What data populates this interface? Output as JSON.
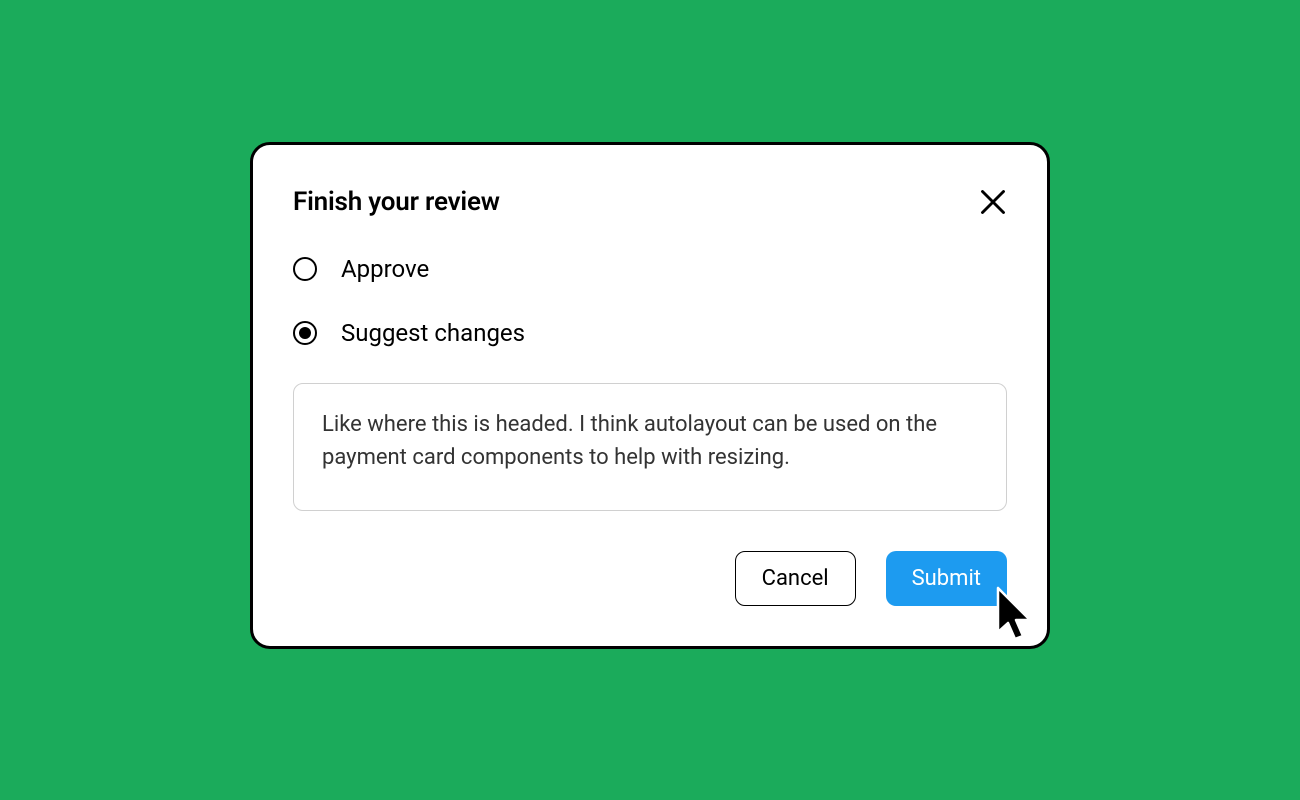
{
  "dialog": {
    "title": "Finish your review",
    "options": [
      {
        "label": "Approve",
        "selected": false
      },
      {
        "label": "Suggest changes",
        "selected": true
      }
    ],
    "comment": "Like where this is headed. I think autolayout can be used on the payment card components to help with resizing.",
    "buttons": {
      "cancel": "Cancel",
      "submit": "Submit"
    }
  },
  "colors": {
    "background": "#1BAB5B",
    "primary": "#1D9BF0"
  }
}
